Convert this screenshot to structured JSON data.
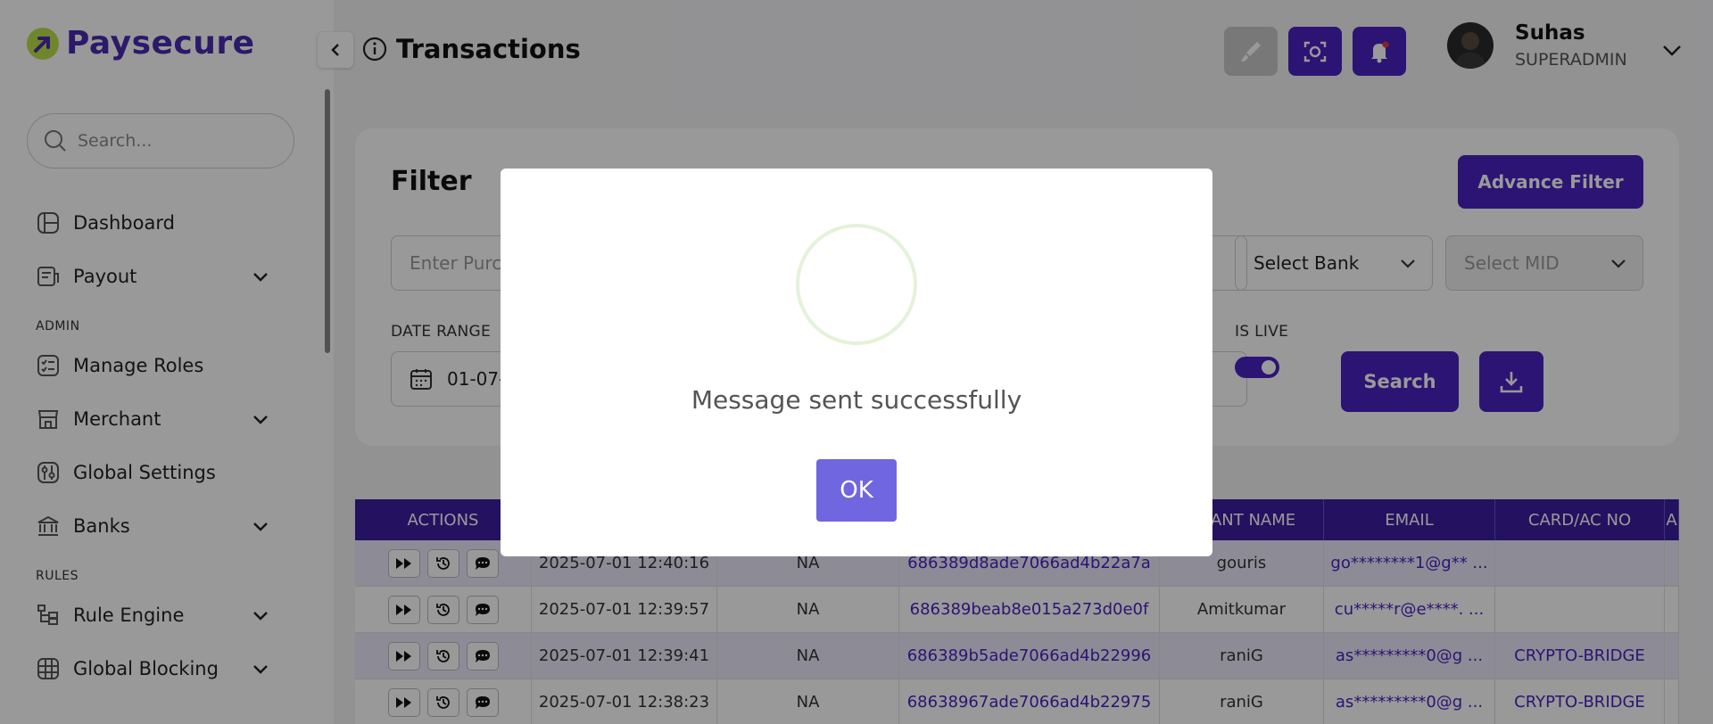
{
  "brand": {
    "name": "Paysecure",
    "accent": "#4a22c2",
    "logo_green": "#b9e04a"
  },
  "sidebar": {
    "search_placeholder": "Search...",
    "items": [
      {
        "label": "Dashboard",
        "icon": "dashboard-icon",
        "expandable": false
      },
      {
        "label": "Payout",
        "icon": "payout-icon",
        "expandable": true
      }
    ],
    "admin_label": "ADMIN",
    "admin_items": [
      {
        "label": "Manage Roles",
        "icon": "roles-icon",
        "expandable": false
      },
      {
        "label": "Merchant",
        "icon": "merchant-icon",
        "expandable": true
      },
      {
        "label": "Global Settings",
        "icon": "settings-icon",
        "expandable": false
      },
      {
        "label": "Banks",
        "icon": "bank-icon",
        "expandable": true
      }
    ],
    "rules_label": "RULES",
    "rules_items": [
      {
        "label": "Rule Engine",
        "icon": "rule-engine-icon",
        "expandable": true
      },
      {
        "label": "Global Blocking",
        "icon": "global-blocking-icon",
        "expandable": true
      }
    ]
  },
  "header": {
    "title": "Transactions",
    "user": {
      "name": "Suhas",
      "role": "SUPERADMIN"
    }
  },
  "filter": {
    "title": "Filter",
    "advance_filter_label": "Advance Filter",
    "purchase_placeholder": "Enter Purc",
    "bank_select": "Select Bank",
    "mid_select": "Select MID",
    "date_range_label": "DATE RANGE",
    "date_value": "01-07-2",
    "is_live_label": "IS LIVE",
    "is_live": true,
    "search_label": "Search"
  },
  "table": {
    "headers": [
      "ACTIONS",
      "",
      "",
      "",
      "CHANT NAME",
      "EMAIL",
      "CARD/AC NO",
      "A"
    ],
    "rows": [
      {
        "date": "2025-07-01 12:40:16",
        "ref": "NA",
        "id": "686389d8ade7066ad4b22a7a",
        "merchant": "gouris",
        "email": "go********1@g** ...",
        "card": ""
      },
      {
        "date": "2025-07-01 12:39:57",
        "ref": "NA",
        "id": "686389beab8e015a273d0e0f",
        "merchant": "Amitkumar",
        "email": "cu*****r@e****. ...",
        "card": ""
      },
      {
        "date": "2025-07-01 12:39:41",
        "ref": "NA",
        "id": "686389b5ade7066ad4b22996",
        "merchant": "raniG",
        "email": "as*********0@g ...",
        "card": "CRYPTO-BRIDGE"
      },
      {
        "date": "2025-07-01 12:38:23",
        "ref": "NA",
        "id": "68638967ade7066ad4b22975",
        "merchant": "raniG",
        "email": "as*********0@g ...",
        "card": "CRYPTO-BRIDGE"
      }
    ]
  },
  "modal": {
    "message": "Message sent successfully",
    "ok_label": "OK"
  }
}
